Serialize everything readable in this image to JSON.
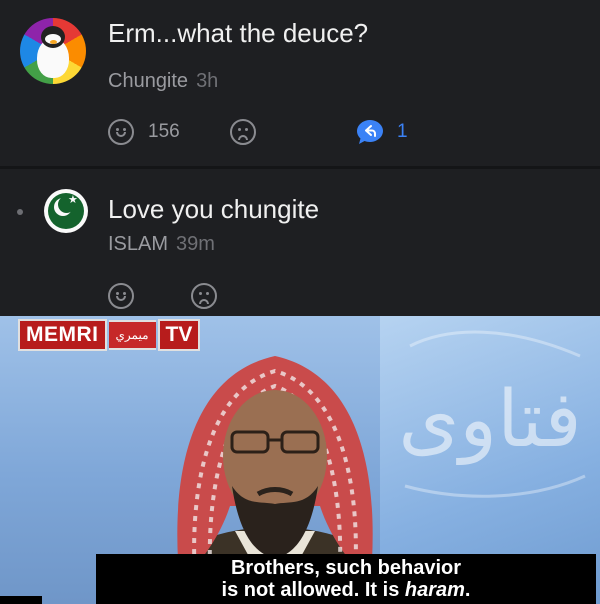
{
  "comments": [
    {
      "text": "Erm...what the deuce?",
      "author": "Chungite",
      "time": "3h",
      "likes": "156",
      "replies": "1",
      "avatar_icon": "pride-penguin-avatar"
    },
    {
      "text": "Love you chungite",
      "author": "ISLAM",
      "time": "39m",
      "avatar_icon": "pakistan-flag-avatar"
    }
  ],
  "meme": {
    "logo_left": "MEMRI",
    "logo_arabic": "ميمري",
    "logo_right": "TV",
    "subtitle_line1": "Brothers, such behavior",
    "subtitle_line2_prefix": "is not allowed. It is ",
    "subtitle_line2_emph": "haram",
    "subtitle_line2_suffix": ".",
    "background_script": "فتاوى"
  },
  "colors": {
    "panel_bg": "#1e1f22",
    "reply_accent": "#3b82f6",
    "memri_red": "#b71c1c"
  }
}
